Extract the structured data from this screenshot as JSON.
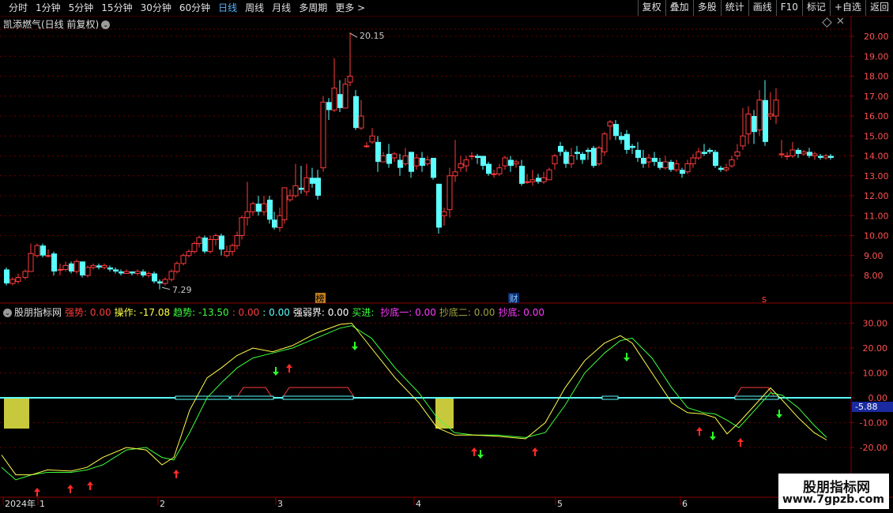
{
  "toolbar": {
    "periods": [
      "分时",
      "1分钟",
      "5分钟",
      "15分钟",
      "30分钟",
      "60分钟",
      "日线",
      "周线",
      "月线",
      "多周期",
      "更多 >"
    ],
    "active": "日线",
    "buttons": [
      "复权",
      "叠加",
      "多股",
      "统计",
      "画线",
      "F10",
      "标记",
      "+自选",
      "返回"
    ]
  },
  "main_chart": {
    "title": "凯添燃气(日线 前复权)",
    "high_label": "20.15",
    "low_label": "7.29",
    "price_ticks": [
      "20.00",
      "19.00",
      "18.00",
      "17.00",
      "16.00",
      "15.00",
      "14.00",
      "13.00",
      "12.00",
      "11.00",
      "10.00",
      "9.00",
      "8.00"
    ],
    "markers": {
      "bang": "榜",
      "cai": "财",
      "s": "s"
    }
  },
  "indicator": {
    "name": "股朋指标网",
    "fields": [
      {
        "label": "强势:",
        "value": "0.00",
        "color": "#ff3b3b"
      },
      {
        "label": "操作:",
        "value": "-17.08",
        "color": "#ffff4a"
      },
      {
        "label": "趋势:",
        "value": "-13.50",
        "color": "#3cff3c"
      },
      {
        "label": ":",
        "value": "0.00",
        "color": "#ff3b3b"
      },
      {
        "label": ":",
        "value": "0.00",
        "color": "#5affff"
      },
      {
        "label": "强弱界:",
        "value": "0.00",
        "color": "#ffffff"
      },
      {
        "label": "买进:",
        "value": "",
        "color": "#3cff3c"
      },
      {
        "label": "抄底一:",
        "value": "0.00",
        "color": "#ff3bff"
      },
      {
        "label": "抄底二:",
        "value": "0.00",
        "color": "#a0a040"
      },
      {
        "label": "抄底:",
        "value": "0.00",
        "color": "#ff3bff"
      }
    ],
    "y_ticks": [
      "30.00",
      "20.00",
      "10.00",
      "0.00",
      "-10.00",
      "-20.00"
    ],
    "current_value": "-5.88"
  },
  "x_axis": {
    "labels": [
      "2024年",
      "1",
      "2",
      "3",
      "4",
      "5",
      "6"
    ]
  },
  "watermark": {
    "line1": "股朋指标网",
    "line2": "www.7gpzb.com"
  },
  "colors": {
    "up": "#ff3b3b",
    "down": "#5affff",
    "fast_line": "#ffff4a",
    "slow_line": "#3cff3c",
    "zero_line": "#5affff",
    "grid": "#6a0000",
    "block": "#c8c83c"
  }
}
